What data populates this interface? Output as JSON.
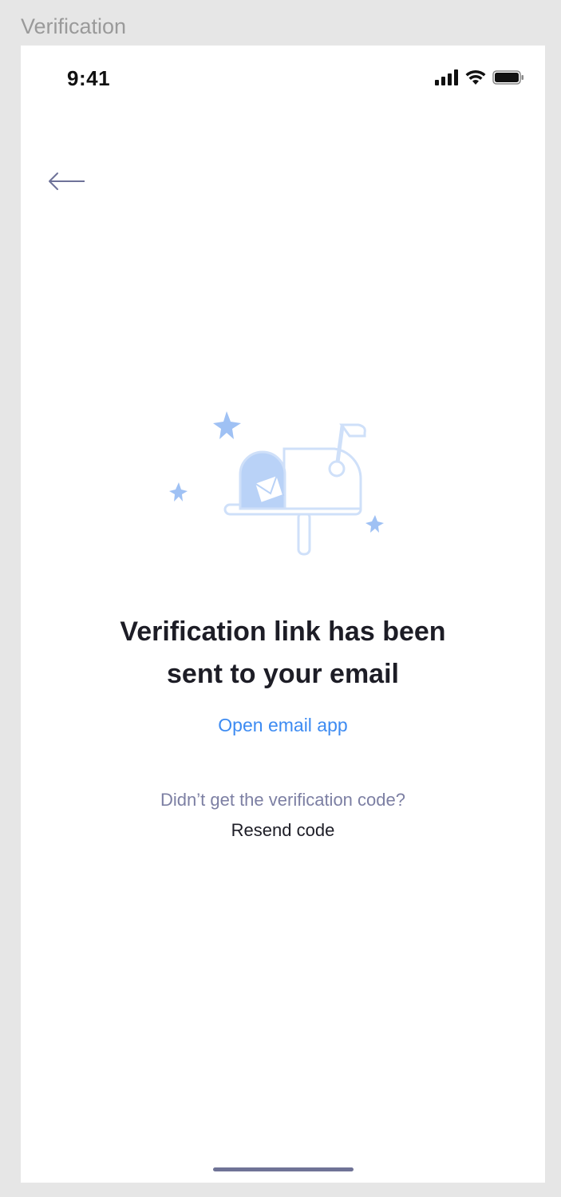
{
  "frame": {
    "label": "Verification"
  },
  "status_bar": {
    "time": "9:41",
    "icons": [
      "cellular-signal-icon",
      "wifi-icon",
      "battery-icon"
    ]
  },
  "nav": {
    "back_icon": "arrow-left-icon"
  },
  "illustration": {
    "icon": "mailbox-with-letter-illustration",
    "accent_color": "#b9d2f7",
    "outline_color": "#cfe0f9",
    "sparkle_color": "#9fc1f4"
  },
  "content": {
    "headline_line1": "Verification link has been",
    "headline_line2": "sent to your email",
    "open_email_label": "Open email app",
    "resend_prompt": "Didn’t get the verification code?",
    "resend_label": "Resend code"
  },
  "colors": {
    "link": "#3d8bf2",
    "muted_text": "#7c7fa3",
    "primary_text": "#1d1d26",
    "home_indicator": "#6f7396"
  }
}
